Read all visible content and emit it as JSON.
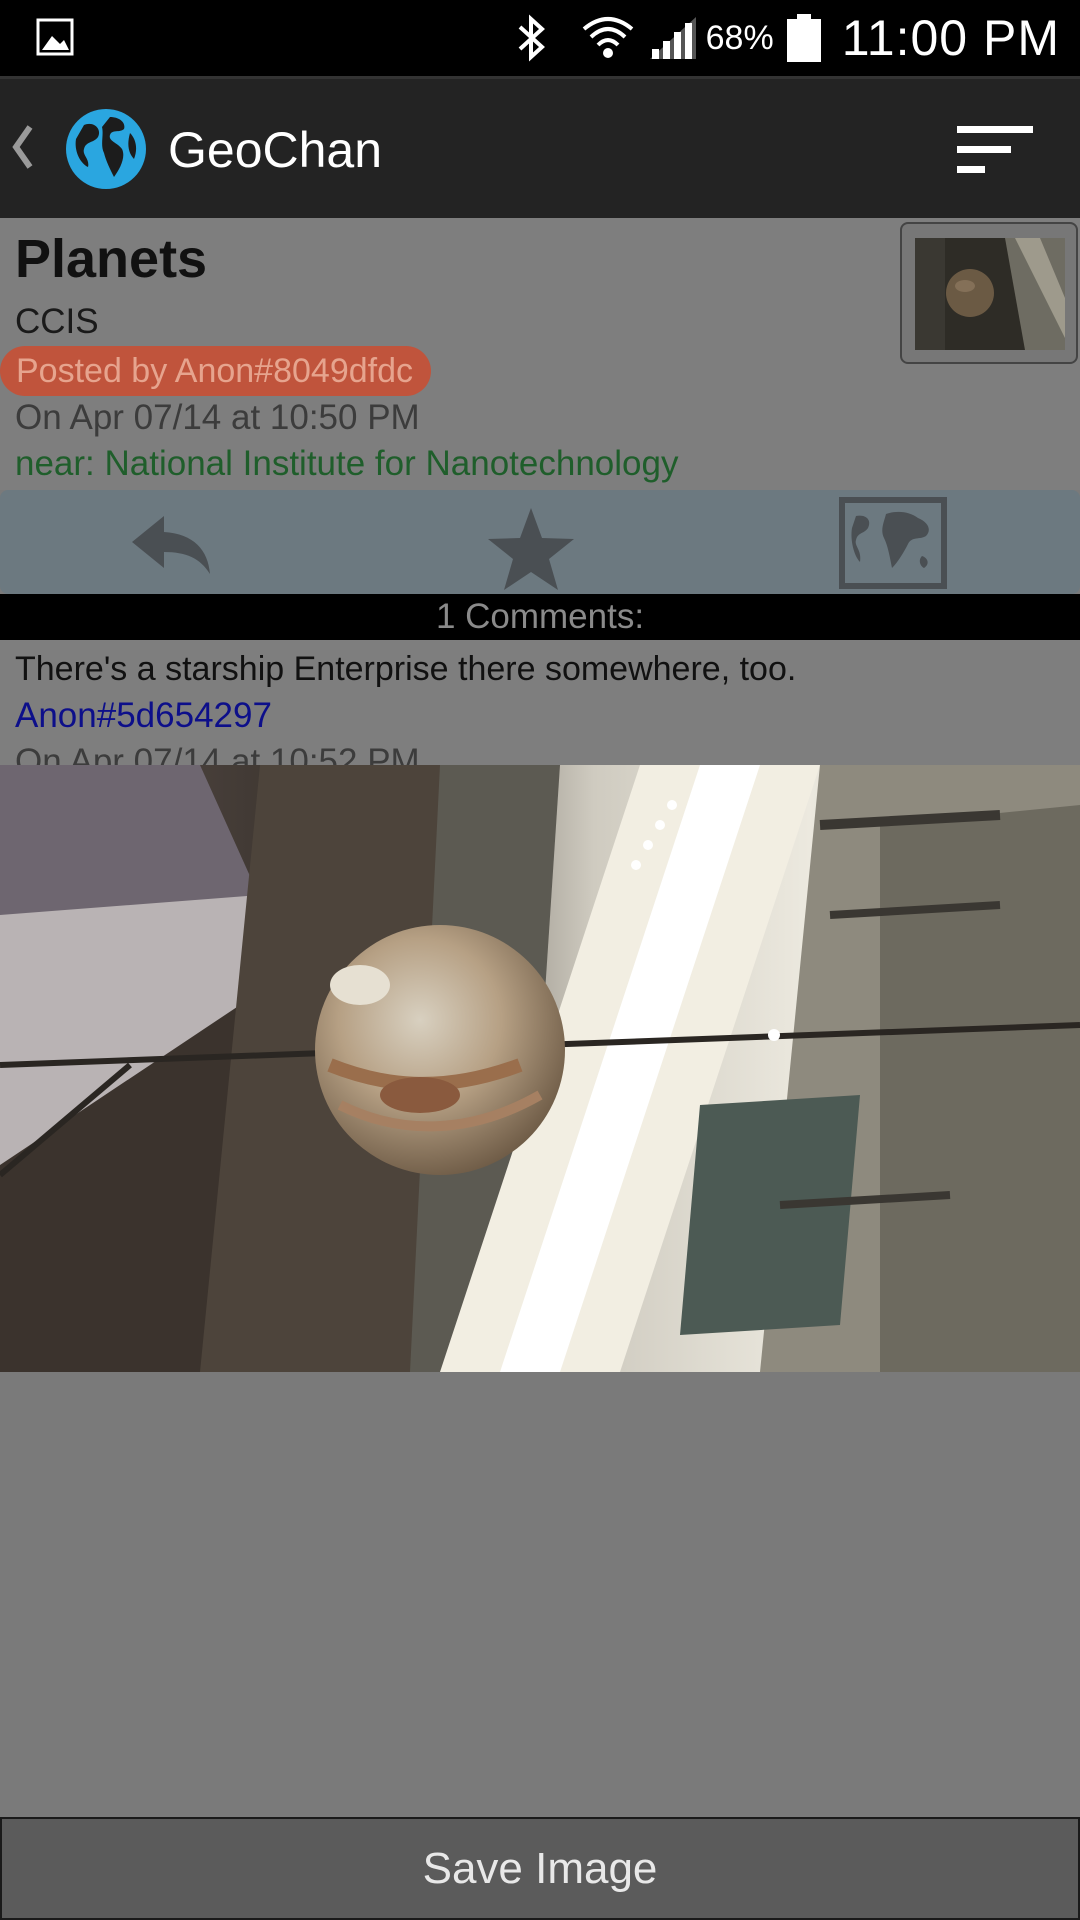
{
  "status_bar": {
    "battery_percent": "68%",
    "time": "11:00 PM",
    "icons": [
      "gallery-icon",
      "bluetooth-icon",
      "wifi-icon",
      "signal-icon",
      "battery-icon"
    ]
  },
  "action_bar": {
    "title": "GeoChan",
    "icons": [
      "up-chevron-icon",
      "globe-icon",
      "menu-icon"
    ]
  },
  "post": {
    "title": "Planets",
    "location": "CCIS",
    "author": "Posted by Anon#8049dfdc",
    "date": "On Apr 07/14 at 10:50 PM",
    "near": "near: National Institute for Nanotechnology"
  },
  "actions": {
    "icons": [
      "reply-icon",
      "star-icon",
      "map-icon"
    ]
  },
  "comments": {
    "header": "1 Comments:",
    "items": [
      {
        "text": "There's a starship Enterprise there somewhere, too.",
        "author": "Anon#5d654297",
        "date": "On Apr 07/14 at 10:52 PM"
      }
    ]
  },
  "save_button": {
    "label": "Save Image"
  },
  "colors": {
    "status_bar_bg": "#000000",
    "action_bar_bg": "#232323",
    "author_badge_bg": "#c0543c",
    "near_text": "#1f5e2b",
    "comment_author": "#0d0f8a",
    "action_row_bg": "#6c7980",
    "globe_blue": "#2aa6e0"
  }
}
